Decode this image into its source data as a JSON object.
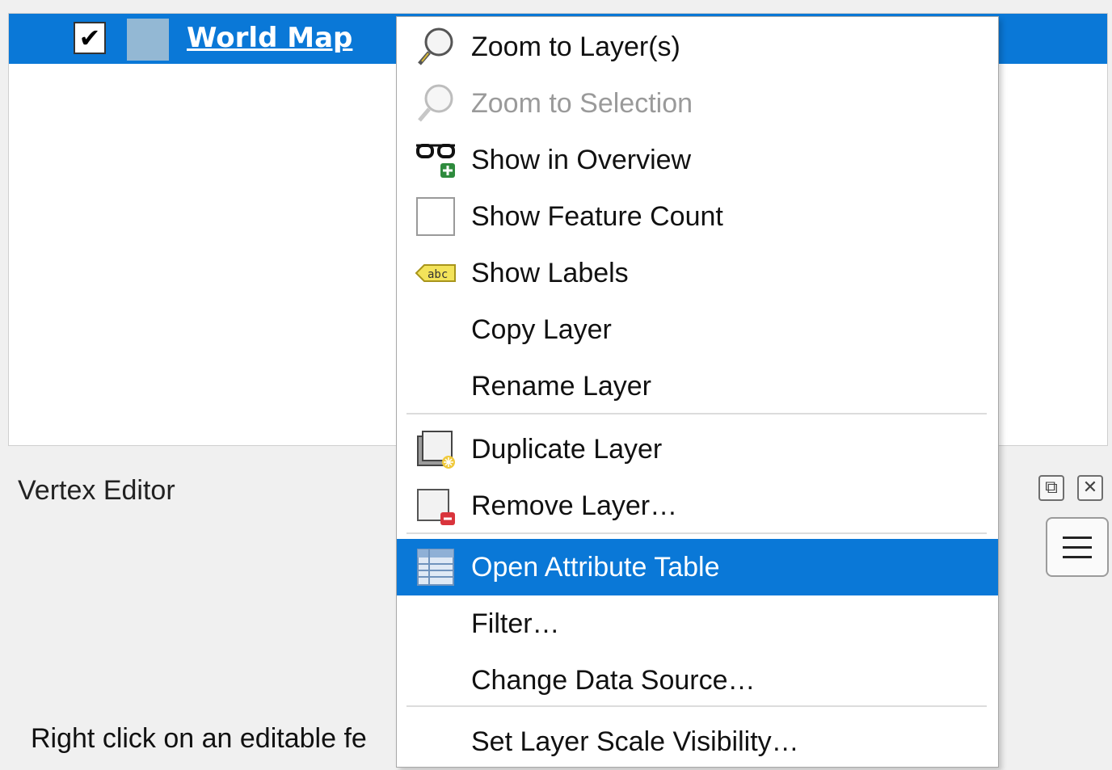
{
  "layers": {
    "layer_name": "World Map",
    "checked_mark": "✔"
  },
  "vertex_editor": {
    "title": "Vertex Editor",
    "hint": "Right click on an editable fe"
  },
  "context_menu": {
    "items": [
      {
        "label": "Zoom to Layer(s)",
        "icon": "zoom-magnifier-icon"
      },
      {
        "label": "Zoom to Selection",
        "icon": "zoom-selection-icon",
        "disabled": true
      },
      {
        "label": "Show in Overview",
        "icon": "glasses-add-icon"
      },
      {
        "label": "Show Feature Count",
        "icon": "checkbox-icon"
      },
      {
        "label": "Show Labels",
        "icon": "label-abc-icon"
      },
      {
        "label": "Copy Layer"
      },
      {
        "label": "Rename Layer"
      },
      {
        "label": "Duplicate Layer",
        "icon": "duplicate-layer-icon"
      },
      {
        "label": "Remove Layer…",
        "icon": "remove-layer-icon"
      },
      {
        "label": "Open Attribute Table",
        "icon": "attribute-table-icon",
        "selected": true
      },
      {
        "label": "Filter…"
      },
      {
        "label": "Change Data Source…"
      },
      {
        "label": "Set Layer Scale Visibility…"
      }
    ]
  },
  "colors": {
    "selection": "#0a78d7",
    "layer_swatch": "#93b8d4"
  }
}
